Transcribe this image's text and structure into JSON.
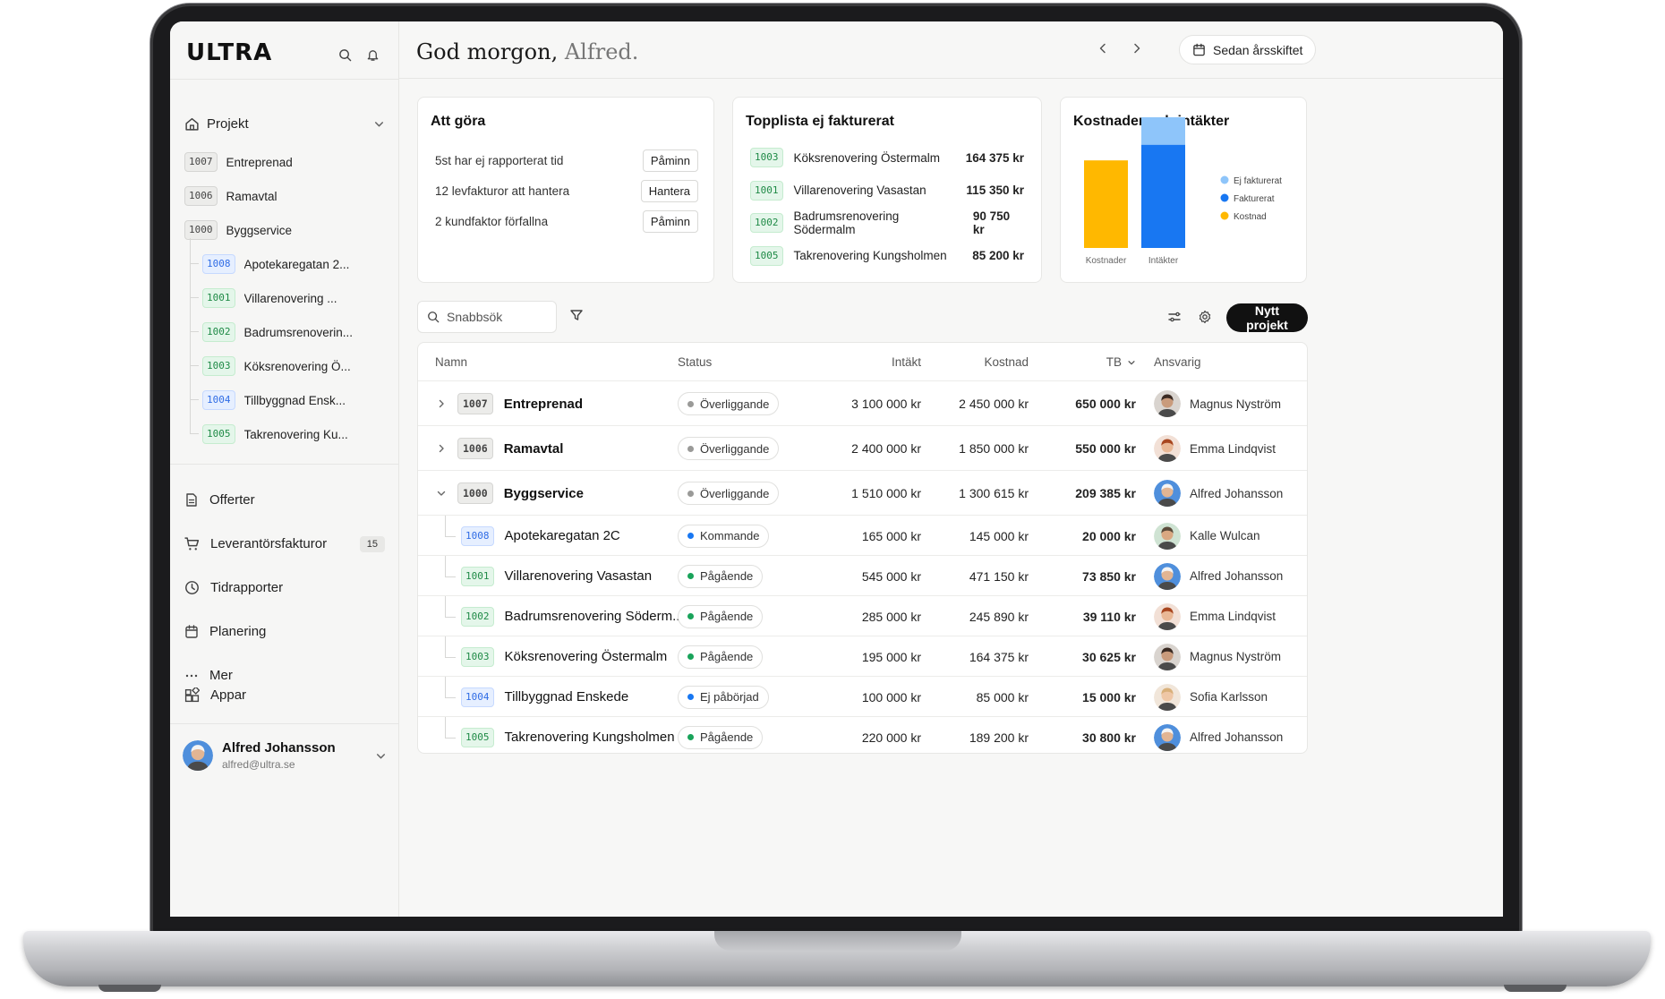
{
  "app": {
    "logo": "ULTRA"
  },
  "sidebar": {
    "projects_header": "Projekt",
    "projects": [
      {
        "code": "1007",
        "label": "Entreprenad",
        "style": "gray",
        "child": false
      },
      {
        "code": "1006",
        "label": "Ramavtal",
        "style": "gray",
        "child": false
      },
      {
        "code": "1000",
        "label": "Byggservice",
        "style": "gray",
        "child": false
      },
      {
        "code": "1008",
        "label": "Apotekaregatan 2...",
        "style": "blue",
        "child": true
      },
      {
        "code": "1001",
        "label": "Villarenovering ...",
        "style": "green",
        "child": true
      },
      {
        "code": "1002",
        "label": "Badrumsrenoverin...",
        "style": "green",
        "child": true
      },
      {
        "code": "1003",
        "label": "Köksrenovering Ö...",
        "style": "green",
        "child": true
      },
      {
        "code": "1004",
        "label": "Tillbyggnad Ensk...",
        "style": "blue",
        "child": true
      },
      {
        "code": "1005",
        "label": "Takrenovering Ku...",
        "style": "green",
        "child": true
      }
    ],
    "nav": {
      "offerter": "Offerter",
      "leverantorsfakturor": "Leverantörsfakturor",
      "leverantorsfakturor_count": "15",
      "tidrapporter": "Tidrapporter",
      "planering": "Planering",
      "mer": "Mer"
    },
    "appar": "Appar",
    "user": {
      "name": "Alfred Johansson",
      "email": "alfred@ultra.se"
    }
  },
  "header": {
    "greeting_prefix": "God morgon,",
    "greeting_name": "Alfred.",
    "period": "Sedan årsskiftet"
  },
  "todo": {
    "title": "Att göra",
    "items": [
      {
        "text": "5st har ej rapporterat tid",
        "action": "Påminn"
      },
      {
        "text": "12 levfakturor att hantera",
        "action": "Hantera"
      },
      {
        "text": "2 kundfaktor förfallna",
        "action": "Påminn"
      }
    ]
  },
  "toplist": {
    "title": "Topplista ej fakturerat",
    "items": [
      {
        "code": "1003",
        "name": "Köksrenovering Östermalm",
        "amount": "164 375 kr"
      },
      {
        "code": "1001",
        "name": "Villarenovering Vasastan",
        "amount": "115 350 kr"
      },
      {
        "code": "1002",
        "name": "Badrumsrenovering Södermalm",
        "amount": "90 750 kr"
      },
      {
        "code": "1005",
        "name": "Takrenovering Kungsholmen",
        "amount": "85 200 kr"
      }
    ]
  },
  "chart_data": {
    "type": "bar",
    "title": "Kostnader och intäkter",
    "categories": [
      "Kostnader",
      "Intäkter"
    ],
    "stacked": true,
    "series": [
      {
        "name": "Kostnad",
        "color": "#FFB800",
        "values": [
          0.67,
          0
        ]
      },
      {
        "name": "Fakturerat",
        "color": "#1877F2",
        "values": [
          0,
          0.79
        ]
      },
      {
        "name": "Ej fakturerat",
        "color": "#8EC5FA",
        "values": [
          0,
          0.21
        ]
      }
    ],
    "legend": [
      "Ej fakturerat",
      "Fakturerat",
      "Kostnad"
    ],
    "legend_position": "right"
  },
  "toolbar": {
    "search_placeholder": "Snabbsök",
    "new_project": "Nytt projekt"
  },
  "table": {
    "columns": {
      "name": "Namn",
      "status": "Status",
      "income": "Intäkt",
      "cost": "Kostnad",
      "tb": "TB",
      "owner": "Ansvarig"
    },
    "rows": [
      {
        "code": "1007",
        "name": "Entreprenad",
        "level": "parent",
        "expand": "collapsed",
        "status": "Överliggande",
        "status_color": "#9a9a98",
        "income": "3 100 000 kr",
        "cost": "2 450 000 kr",
        "tb": "650 000 kr",
        "owner": "Magnus Nyström",
        "avatar": "dark",
        "code_style": "gray"
      },
      {
        "code": "1006",
        "name": "Ramavtal",
        "level": "parent",
        "expand": "collapsed",
        "status": "Överliggande",
        "status_color": "#9a9a98",
        "income": "2 400 000 kr",
        "cost": "1 850 000 kr",
        "tb": "550 000 kr",
        "owner": "Emma Lindqvist",
        "avatar": "red",
        "code_style": "gray"
      },
      {
        "code": "1000",
        "name": "Byggservice",
        "level": "parent",
        "expand": "expanded",
        "status": "Överliggande",
        "status_color": "#9a9a98",
        "income": "1 510 000 kr",
        "cost": "1 300 615 kr",
        "tb": "209 385 kr",
        "owner": "Alfred Johansson",
        "avatar": "helmet",
        "code_style": "gray"
      },
      {
        "code": "1008",
        "name": "Apotekaregatan 2C",
        "level": "child",
        "status": "Kommande",
        "status_color": "#1877F2",
        "income": "165 000 kr",
        "cost": "145 000 kr",
        "tb": "20 000 kr",
        "owner": "Kalle Wulcan",
        "avatar": "green",
        "code_style": "blue"
      },
      {
        "code": "1001",
        "name": "Villarenovering Vasastan",
        "level": "child",
        "status": "Pågående",
        "status_color": "#19a35a",
        "income": "545 000 kr",
        "cost": "471 150 kr",
        "tb": "73 850 kr",
        "owner": "Alfred Johansson",
        "avatar": "helmet",
        "code_style": "green"
      },
      {
        "code": "1002",
        "name": "Badrumsrenovering Söderm...",
        "level": "child",
        "status": "Pågående",
        "status_color": "#19a35a",
        "income": "285 000 kr",
        "cost": "245 890 kr",
        "tb": "39 110 kr",
        "owner": "Emma Lindqvist",
        "avatar": "red",
        "code_style": "green"
      },
      {
        "code": "1003",
        "name": "Köksrenovering Östermalm",
        "level": "child",
        "status": "Pågående",
        "status_color": "#19a35a",
        "income": "195 000 kr",
        "cost": "164 375 kr",
        "tb": "30 625 kr",
        "owner": "Magnus Nyström",
        "avatar": "dark",
        "code_style": "green"
      },
      {
        "code": "1004",
        "name": "Tillbyggnad Enskede",
        "level": "child",
        "status": "Ej påbörjad",
        "status_color": "#1877F2",
        "income": "100 000 kr",
        "cost": "85 000 kr",
        "tb": "15 000 kr",
        "owner": "Sofia Karlsson",
        "avatar": "blonde",
        "code_style": "blue"
      },
      {
        "code": "1005",
        "name": "Takrenovering Kungsholmen",
        "level": "child",
        "status": "Pågående",
        "status_color": "#19a35a",
        "income": "220 000 kr",
        "cost": "189 200 kr",
        "tb": "30 800 kr",
        "owner": "Alfred Johansson",
        "avatar": "helmet",
        "code_style": "green"
      }
    ]
  }
}
